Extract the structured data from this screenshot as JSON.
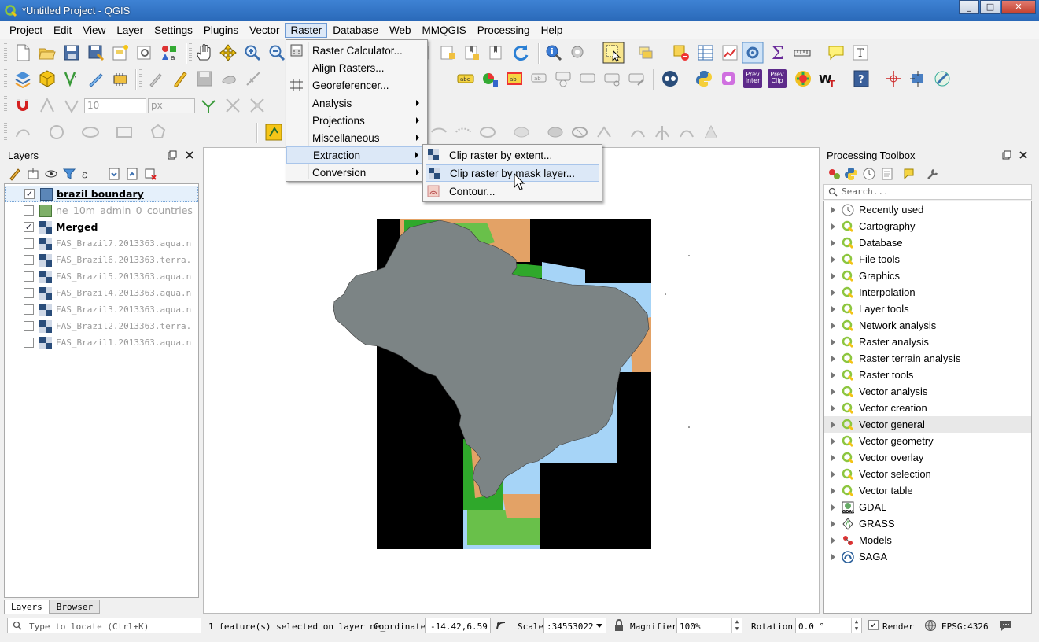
{
  "window": {
    "title": "*Untitled Project - QGIS",
    "controls": [
      "_",
      "□",
      "✕"
    ]
  },
  "menubar": {
    "items": [
      "Project",
      "Edit",
      "View",
      "Layer",
      "Settings",
      "Plugins",
      "Vector",
      "Raster",
      "Database",
      "Web",
      "MMQGIS",
      "Processing",
      "Help"
    ],
    "active": "Raster"
  },
  "toolbar": {
    "snap_tolerance": "10",
    "snap_units": "px",
    "prev_inter": "Prev Inter",
    "prev_clip": "Prev Clip"
  },
  "raster_menu": {
    "items": [
      {
        "label": "Raster Calculator...",
        "submenu": false
      },
      {
        "label": "Align Rasters...",
        "submenu": false
      },
      {
        "label": "Georeferencer...",
        "submenu": false
      },
      {
        "label": "Analysis",
        "submenu": true
      },
      {
        "label": "Projections",
        "submenu": true
      },
      {
        "label": "Miscellaneous",
        "submenu": true
      },
      {
        "label": "Extraction",
        "submenu": true
      },
      {
        "label": "Conversion",
        "submenu": true
      }
    ],
    "hovered": "Extraction"
  },
  "extraction_menu": {
    "items": [
      {
        "label": "Clip raster by extent..."
      },
      {
        "label": "Clip raster by mask layer..."
      },
      {
        "label": "Contour..."
      }
    ],
    "hovered": "Clip raster by mask layer..."
  },
  "layers_panel": {
    "title": "Layers",
    "layers": [
      {
        "name": "brazil boundary",
        "checked": true,
        "style": "bold-underline",
        "selected": true,
        "type": "polygon-blue"
      },
      {
        "name": "ne_10m_admin_0_countries",
        "checked": false,
        "style": "grey",
        "type": "polygon-green"
      },
      {
        "name": "Merged",
        "checked": true,
        "style": "bold",
        "type": "raster"
      },
      {
        "name": "FAS_Brazil7.2013363.aqua.n",
        "checked": false,
        "style": "mono",
        "type": "raster"
      },
      {
        "name": "FAS_Brazil6.2013363.terra.",
        "checked": false,
        "style": "mono",
        "type": "raster"
      },
      {
        "name": "FAS_Brazil5.2013363.aqua.n",
        "checked": false,
        "style": "mono",
        "type": "raster"
      },
      {
        "name": "FAS_Brazil4.2013363.aqua.n",
        "checked": false,
        "style": "mono",
        "type": "raster"
      },
      {
        "name": "FAS_Brazil3.2013363.aqua.n",
        "checked": false,
        "style": "mono",
        "type": "raster"
      },
      {
        "name": "FAS_Brazil2.2013363.terra.",
        "checked": false,
        "style": "mono",
        "type": "raster"
      },
      {
        "name": "FAS_Brazil1.2013363.aqua.n",
        "checked": false,
        "style": "mono",
        "type": "raster"
      }
    ],
    "tabs": [
      "Layers",
      "Browser"
    ]
  },
  "toolbox": {
    "title": "Processing Toolbox",
    "search_placeholder": "Search...",
    "items": [
      {
        "label": "Recently used",
        "icon": "clock-icon"
      },
      {
        "label": "Cartography",
        "icon": "qgis-icon"
      },
      {
        "label": "Database",
        "icon": "qgis-icon"
      },
      {
        "label": "File tools",
        "icon": "qgis-icon"
      },
      {
        "label": "Graphics",
        "icon": "qgis-icon"
      },
      {
        "label": "Interpolation",
        "icon": "qgis-icon"
      },
      {
        "label": "Layer tools",
        "icon": "qgis-icon"
      },
      {
        "label": "Network analysis",
        "icon": "qgis-icon"
      },
      {
        "label": "Raster analysis",
        "icon": "qgis-icon"
      },
      {
        "label": "Raster terrain analysis",
        "icon": "qgis-icon"
      },
      {
        "label": "Raster tools",
        "icon": "qgis-icon"
      },
      {
        "label": "Vector analysis",
        "icon": "qgis-icon"
      },
      {
        "label": "Vector creation",
        "icon": "qgis-icon"
      },
      {
        "label": "Vector general",
        "icon": "qgis-icon",
        "highlight": true
      },
      {
        "label": "Vector geometry",
        "icon": "qgis-icon"
      },
      {
        "label": "Vector overlay",
        "icon": "qgis-icon"
      },
      {
        "label": "Vector selection",
        "icon": "qgis-icon"
      },
      {
        "label": "Vector table",
        "icon": "qgis-icon"
      },
      {
        "label": "GDAL",
        "icon": "gdal-icon"
      },
      {
        "label": "GRASS",
        "icon": "grass-icon"
      },
      {
        "label": "Models",
        "icon": "models-icon"
      },
      {
        "label": "SAGA",
        "icon": "saga-icon"
      }
    ]
  },
  "statusbar": {
    "locator_placeholder": "Type to locate (Ctrl+K)",
    "message": "1 feature(s) selected on layer ne_",
    "coordinate_label": "Coordinate",
    "coordinate_value": "-14.42,6.59",
    "scale_label": "Scale",
    "scale_value": ":34553022",
    "magnifier_label": "Magnifier",
    "magnifier_value": "100%",
    "rotation_label": "Rotation",
    "rotation_value": "0.0 °",
    "render_label": "Render",
    "render_checked": true,
    "crs": "EPSG:4326"
  },
  "colors": {
    "brazil_fill": "#7c8485",
    "raster_nodata": "#000000",
    "water": "#a6d4f7",
    "vegetation": "#2fa82b",
    "dry": "#e3a266",
    "menu_hover": "#dce8f7"
  }
}
